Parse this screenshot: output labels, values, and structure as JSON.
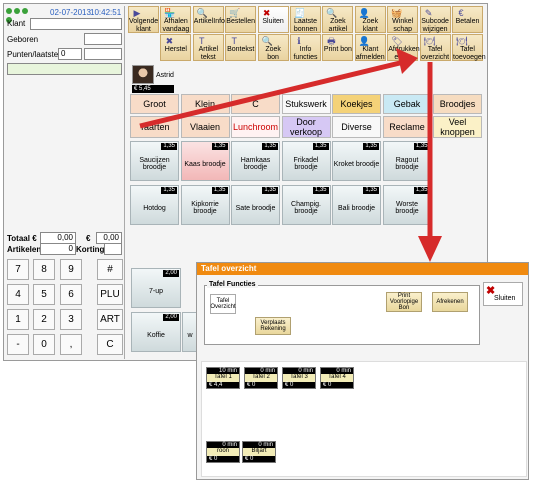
{
  "status": {
    "date": "02-07-2013",
    "time": "10:42:51"
  },
  "form": {
    "klant_label": "Klant",
    "geboren_label": "Geboren",
    "punten_label": "Punten/laatste",
    "punten_value": "0"
  },
  "totals": {
    "totaal_label": "Totaal €",
    "totaal_value": "0,00",
    "euro_label": "€",
    "euro_value": "0,00",
    "artikelen_label": "Artikelen",
    "artikelen_value": "0",
    "korting_label": "Korting"
  },
  "keypad": [
    "7",
    "8",
    "9",
    "#",
    "4",
    "5",
    "6",
    "PLU",
    "1",
    "2",
    "3",
    "ART",
    "-",
    "0",
    ",",
    "C"
  ],
  "toolbar": [
    "Volgende klant",
    "Afhalen vandaag",
    "ArtikelInfo",
    "Bestellen",
    "Sluiten",
    "Laatste bonnen",
    "Zoek artikel",
    "Zoek klant",
    "Winkel schap",
    "Subcode wijzigen",
    "Betalen",
    "Herstel",
    "Artikel tekst",
    "Bontekst",
    "Zoek bon",
    "Info functies",
    "Print bon",
    "Klant afmelden",
    "Afdrukken etiket",
    "Tafel overzicht",
    "Tafel toevoegen"
  ],
  "user": {
    "name": "Astrid",
    "balance": "€ 5,45"
  },
  "categories_row1": [
    "Groot",
    "Klein",
    "C",
    "Stukswerk",
    "Koekjes",
    "Gebak",
    "Broodjes"
  ],
  "categories_row2": [
    "Taarten",
    "Vlaaien",
    "Lunchroom",
    "Door verkoop",
    "Diverse",
    "Reclame",
    "Veel knoppen"
  ],
  "products": [
    {
      "price": "1,35",
      "name": "Saucijzen broodje"
    },
    {
      "price": "1,35",
      "name": "Kaas broodje"
    },
    {
      "price": "1,35",
      "name": "Hamkaas broodje"
    },
    {
      "price": "1,35",
      "name": "Frikadel broodje"
    },
    {
      "price": "1,35",
      "name": "Kroket broodje"
    },
    {
      "price": "1,35",
      "name": "Ragout broodje"
    },
    {
      "price": "1,35",
      "name": "Hotdog"
    },
    {
      "price": "1,35",
      "name": "Kipkorrie broodje"
    },
    {
      "price": "1,35",
      "name": "Sate broodje"
    },
    {
      "price": "1,35",
      "name": "Champig. broodje"
    },
    {
      "price": "1,35",
      "name": "Bali broodje"
    },
    {
      "price": "1,35",
      "name": "Worste broodje"
    }
  ],
  "lower_products": [
    {
      "price": "2,00",
      "name": "7-up"
    },
    {
      "price": "2,00",
      "name": "Koffie"
    },
    {
      "name": "w"
    }
  ],
  "popup": {
    "title": "Tafel overzicht",
    "group_label": "Tafel Functies",
    "btn_overzicht": "Tafel Overzicht",
    "btn_verplaats": "Verplaats Rekening",
    "btn_print": "Print Voorlopige Bon",
    "btn_afrekenen": "Afrekenen",
    "btn_sluiten": "Sluiten",
    "tables": [
      {
        "time": "10 min",
        "name": "Tafel 1",
        "amount": "€ 4,4"
      },
      {
        "time": "0 min",
        "name": "Tafel 2",
        "amount": "€ 0"
      },
      {
        "time": "0 min",
        "name": "Tafel 3",
        "amount": "€ 0"
      },
      {
        "time": "0 min",
        "name": "Tafel 4",
        "amount": "€ 0"
      },
      {
        "time": "0 min",
        "name": "roon",
        "amount": "€ 0"
      },
      {
        "time": "0 min",
        "name": "Biljart",
        "amount": "€ 0"
      }
    ]
  },
  "colors": {
    "arrow": "#d62b2b",
    "popup_title": "#f08a10",
    "lunchroom": "#cc0000"
  }
}
